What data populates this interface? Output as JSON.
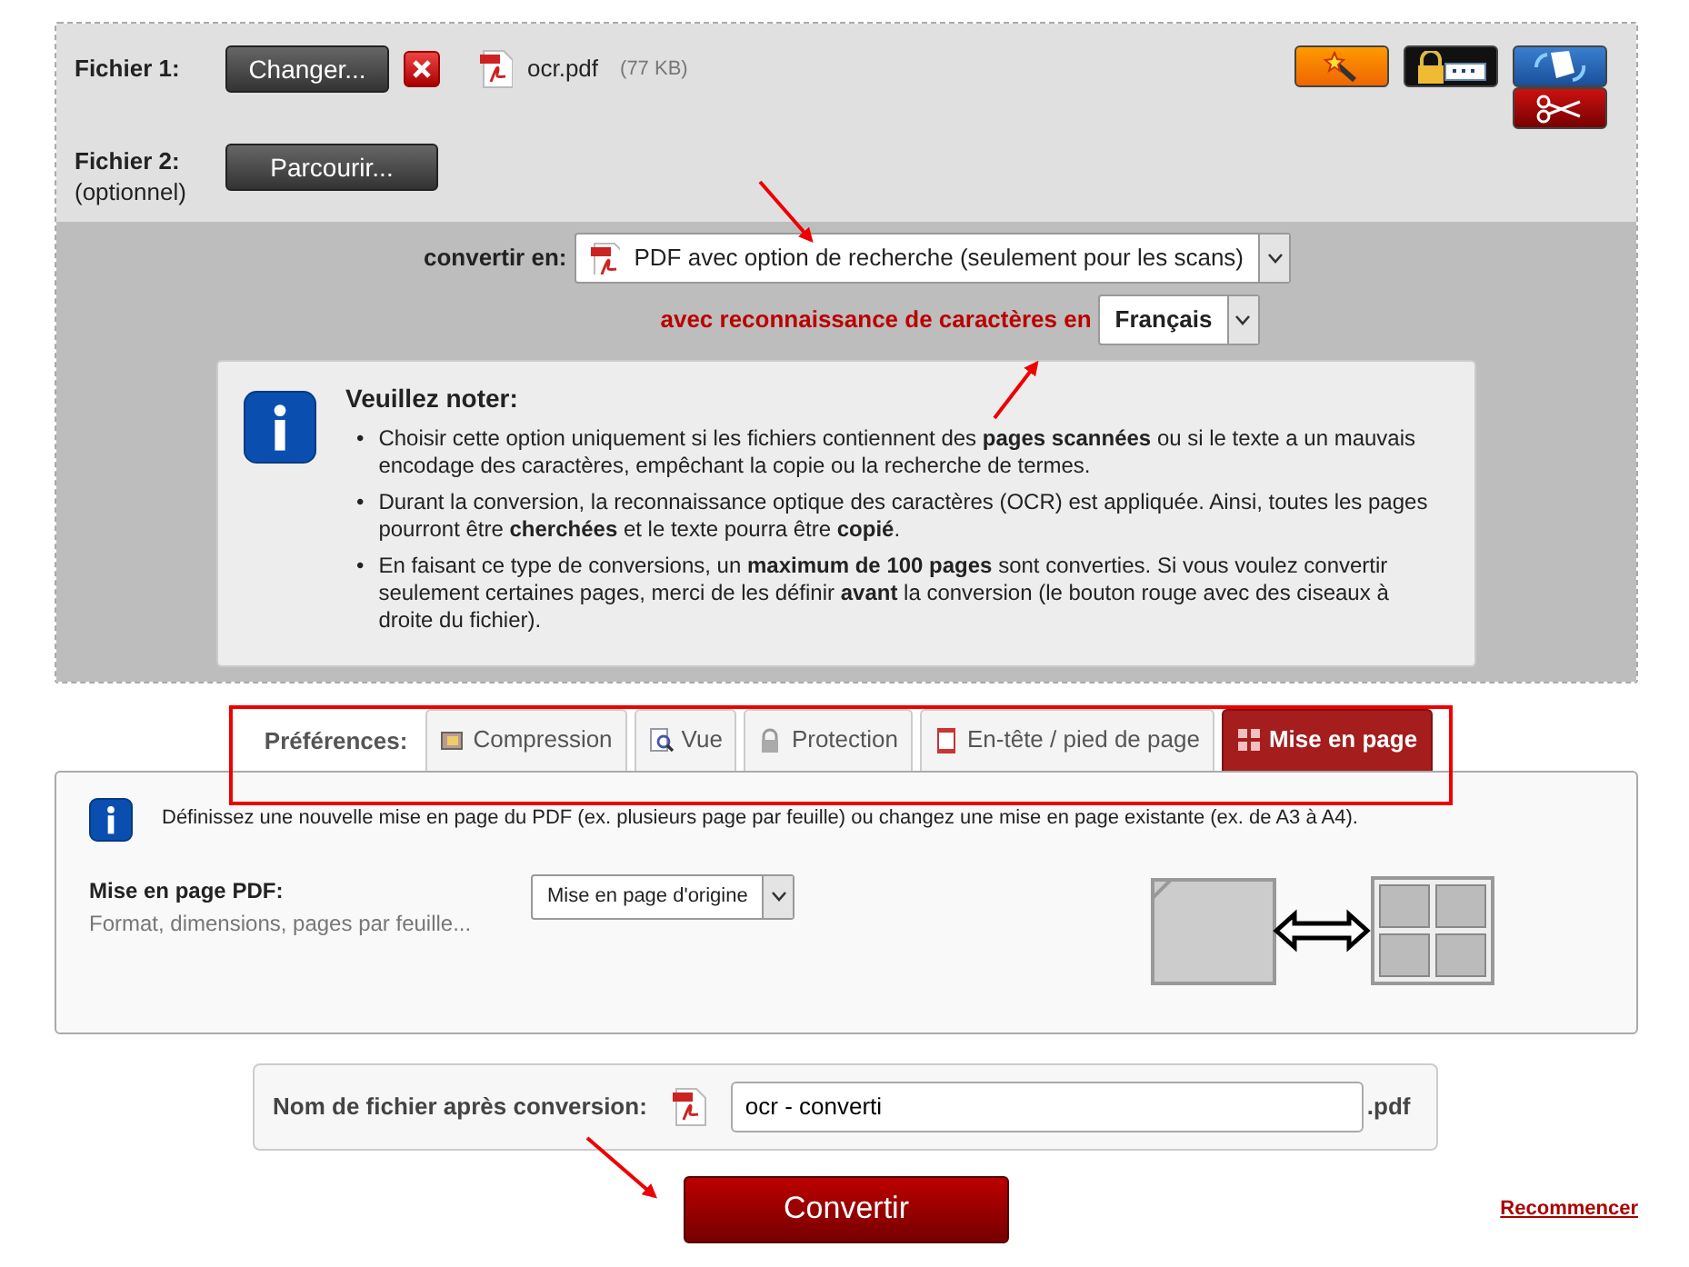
{
  "file_1": {
    "label": "Fichier 1:",
    "button": "Changer...",
    "file_name": "ocr.pdf",
    "file_size": "(77 KB)"
  },
  "file_2": {
    "label": "Fichier 2:",
    "note": "(optionnel)",
    "button": "Parcourir..."
  },
  "convert": {
    "label": "convertir en:",
    "value": "PDF avec option de recherche (seulement pour les scans)"
  },
  "ocr": {
    "label": "avec reconnaissance de caractères en",
    "value": "Français"
  },
  "note": {
    "title": "Veuillez noter:",
    "items": [
      {
        "bullet": "•",
        "text": "Choisir cette option uniquement si les fichiers contiennent des **pages scannées** ou si le texte a un mauvais encodage des caractères, empêchant la copie ou la recherche de termes."
      },
      {
        "bullet": "•",
        "text": "Durant la conversion, la reconnaissance optique des caractères (OCR) est appliquée. Ainsi, toutes les pages pourront être **cherchées** et le texte pourra être **copié**."
      },
      {
        "bullet": "•",
        "text": "En faisant ce type de conversions, un **maximum de 100 pages** sont converties. Si vous voulez convertir seulement certaines pages, merci de les définir **avant** la conversion (le bouton rouge avec des ciseaux à droite du fichier)."
      }
    ]
  },
  "preferences": {
    "label": "Préférences:",
    "tabs": [
      {
        "kind": "compression",
        "label": "Compression",
        "selected": false
      },
      {
        "kind": "view",
        "label": "Vue",
        "selected": false
      },
      {
        "kind": "protection",
        "label": "Protection",
        "selected": false
      },
      {
        "kind": "header",
        "label": "En-tête / pied de page",
        "selected": false
      },
      {
        "kind": "layout",
        "label": "Mise en page",
        "selected": true
      }
    ]
  },
  "layout_panel": {
    "description": "Définissez une nouvelle mise en page du PDF (ex. plusieurs page par feuille) ou changez une mise en page existante (ex. de A3 à A4).",
    "field_label": "Mise en page PDF:",
    "field_hint": "Format, dimensions, pages par feuille...",
    "select_value": "Mise en page d'origine"
  },
  "output": {
    "label": "Nom de fichier après conversion:",
    "value": "ocr - converti",
    "extension": ".pdf"
  },
  "convert_button": "Convertir",
  "restart_link": "Recommencer"
}
